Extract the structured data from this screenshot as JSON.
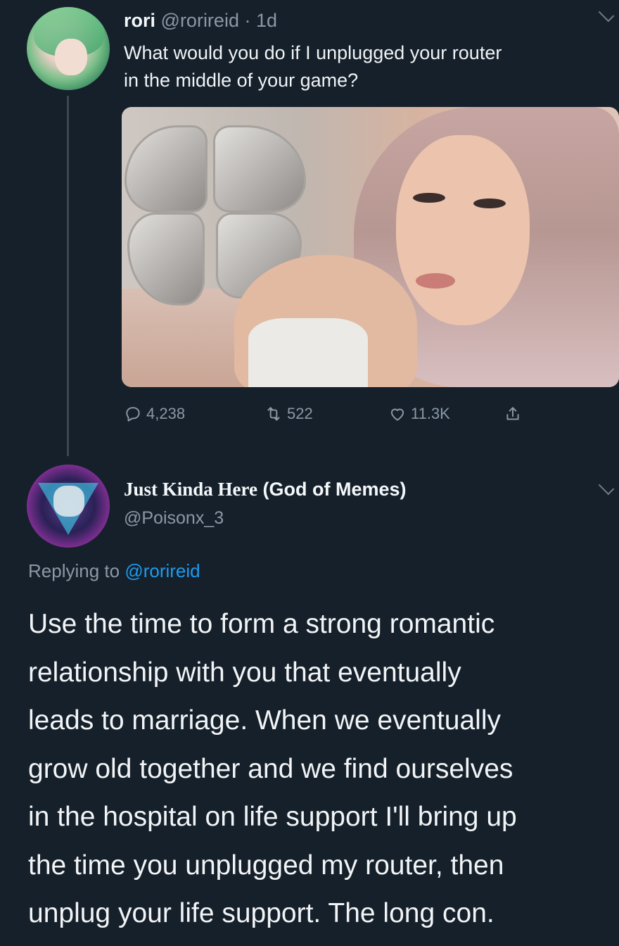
{
  "tweet": {
    "display_name": "rori",
    "handle": "@rorireid",
    "time": "· 1d",
    "text_lines": [
      "What would you do if I unplugged your router",
      "in the middle of your game?"
    ],
    "stats": {
      "replies": "4,238",
      "retweets": "522",
      "likes": "11.3K"
    }
  },
  "reply": {
    "display_name_serif": "Just Kinda Here",
    "display_name_rest": " (God of Memes)",
    "handle": "@Poisonx_3",
    "replying_prefix": "Replying to ",
    "replying_to": "@rorireid",
    "text_lines": [
      "Use the time to form a strong romantic",
      "relationship with you that eventually",
      "leads to marriage. When we eventually",
      "grow old together and we find ourselves",
      "in the hospital on life support I'll bring up",
      "the time you unplugged my router, then",
      "unplug your life support. The long con."
    ]
  },
  "icons": [
    "reply-icon",
    "retweet-icon",
    "like-icon",
    "share-icon",
    "chevron-down-icon"
  ],
  "colors": {
    "background": "#15202b",
    "link": "#1d9bf0",
    "muted": "#8b98a5"
  }
}
